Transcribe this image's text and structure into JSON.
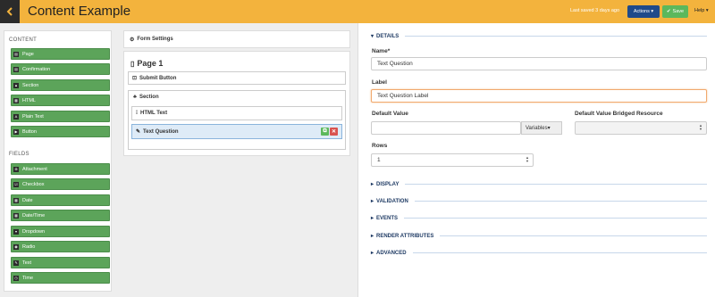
{
  "header": {
    "title": "Content Example",
    "last_saved": "Last saved 3 days ago",
    "actions_label": "Actions ▾",
    "save_label": "Save",
    "help_label": "Help ▾"
  },
  "palette": {
    "content_heading": "CONTENT",
    "content_items": [
      {
        "label": "Page",
        "icon": "page-icon"
      },
      {
        "label": "Confirmation",
        "icon": "confirmation-icon"
      },
      {
        "label": "Section",
        "icon": "section-icon"
      },
      {
        "label": "HTML",
        "icon": "html-icon"
      },
      {
        "label": "Plain Text",
        "icon": "plain-text-icon"
      },
      {
        "label": "Button",
        "icon": "button-icon"
      }
    ],
    "fields_heading": "FIELDS",
    "field_items": [
      {
        "label": "Attachment",
        "icon": "attachment-icon"
      },
      {
        "label": "Checkbox",
        "icon": "checkbox-icon"
      },
      {
        "label": "Date",
        "icon": "date-icon"
      },
      {
        "label": "Date/Time",
        "icon": "datetime-icon"
      },
      {
        "label": "Dropdown",
        "icon": "dropdown-icon"
      },
      {
        "label": "Radio",
        "icon": "radio-icon"
      },
      {
        "label": "Text",
        "icon": "text-icon"
      },
      {
        "label": "Time",
        "icon": "time-icon"
      }
    ]
  },
  "builder": {
    "form_settings": "Form Settings",
    "page_title": "Page 1",
    "submit_button": "Submit Button",
    "section_label": "Section",
    "html_text": "HTML Text",
    "text_question": "Text Question"
  },
  "details": {
    "heading": "DETAILS",
    "name_label": "Name*",
    "name_value": "Text Question",
    "label_label": "Label",
    "label_value": "Text Question Label",
    "default_value_label": "Default Value",
    "default_value_value": "",
    "variables_label": "Variables▾",
    "bridged_label": "Default Value Bridged Resource",
    "rows_label": "Rows",
    "rows_value": "1"
  },
  "sections": [
    "DISPLAY",
    "VALIDATION",
    "EVENTS",
    "RENDER ATTRIBUTES",
    "ADVANCED"
  ],
  "colors": {
    "header": "#f3b33d",
    "palette_button": "#5ca45a",
    "actions_button": "#1f4a8a",
    "save_button": "#5cb85c",
    "accordion_text": "#1f3b64"
  }
}
